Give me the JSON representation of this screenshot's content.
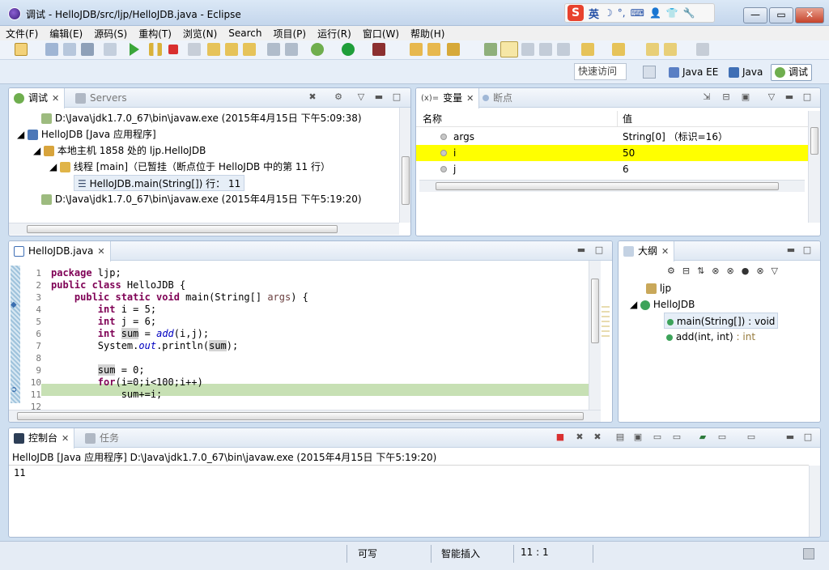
{
  "window": {
    "title": "调试 - HelloJDB/src/ljp/HelloJDB.java - Eclipse",
    "min": "—",
    "max": "▭",
    "close": "✕"
  },
  "ime": {
    "logo": "S",
    "lang": "英",
    "icons": [
      "☽",
      "°,",
      "⌨",
      "👤",
      "👕",
      "🔧"
    ]
  },
  "menu": [
    "文件(F)",
    "编辑(E)",
    "源码(S)",
    "重构(T)",
    "浏览(N)",
    "Search",
    "项目(P)",
    "运行(R)",
    "窗口(W)",
    "帮助(H)"
  ],
  "quick_access": "快速访问",
  "perspectives": [
    {
      "label": "Java EE",
      "active": false
    },
    {
      "label": "Java",
      "active": false
    },
    {
      "label": "调试",
      "active": true
    }
  ],
  "debug_view": {
    "tabs": [
      {
        "label": "调试",
        "active": true
      },
      {
        "label": "Servers",
        "active": false
      }
    ],
    "rows": [
      {
        "text": "D:\\Java\\jdk1.7.0_67\\bin\\javaw.exe (2015年4月15日 下午5:09:38)",
        "indent": 0
      },
      {
        "text": "HelloJDB [Java 应用程序]",
        "indent": 1
      },
      {
        "text": "本地主机 1858 处的 ljp.HelloJDB",
        "indent": 2
      },
      {
        "text": "线程 [main]（已暂挂（断点位于 HelloJDB 中的第 11 行）",
        "indent": 3
      },
      {
        "text": "HelloJDB.main(String[]) 行： 11",
        "indent": 4
      },
      {
        "text": "D:\\Java\\jdk1.7.0_67\\bin\\javaw.exe (2015年4月15日 下午5:19:20)",
        "indent": 0
      }
    ]
  },
  "variables_view": {
    "tabs": [
      {
        "label": "变量",
        "prefix": "(x)=",
        "active": true
      },
      {
        "label": "断点",
        "active": false
      }
    ],
    "columns": [
      "名称",
      "值"
    ],
    "rows": [
      {
        "name": "args",
        "value": "String[0]  （标识=16）",
        "highlight": false
      },
      {
        "name": "i",
        "value": "50",
        "highlight": true
      },
      {
        "name": "j",
        "value": "6",
        "highlight": false
      }
    ],
    "highlight_color": "#ffff00"
  },
  "editor": {
    "tab": "HelloJDB.java",
    "line_numbers": [
      "1",
      "2",
      "3",
      "4",
      "5",
      "6",
      "7",
      "8",
      "9",
      "10",
      "11",
      "12"
    ],
    "current_line": 11,
    "current_line_color": "#c7e0b4"
  },
  "outline": {
    "tab": "大纲",
    "items": [
      {
        "label": "ljp",
        "type": "package"
      },
      {
        "label": "HelloJDB",
        "type": "class"
      },
      {
        "label": "main(String[]) : void",
        "type": "method",
        "static": true,
        "selected": true
      },
      {
        "label": "add(int, int)",
        "suffix": " : int",
        "type": "method",
        "static": true
      }
    ]
  },
  "console": {
    "tabs": [
      {
        "label": "控制台",
        "active": true
      },
      {
        "label": "任务",
        "active": false
      }
    ],
    "header": "HelloJDB [Java 应用程序] D:\\Java\\jdk1.7.0_67\\bin\\javaw.exe (2015年4月15日 下午5:19:20)",
    "output": "11"
  },
  "status": {
    "writable": "可写",
    "insert_mode": "智能插入",
    "position": "11 : 1"
  }
}
